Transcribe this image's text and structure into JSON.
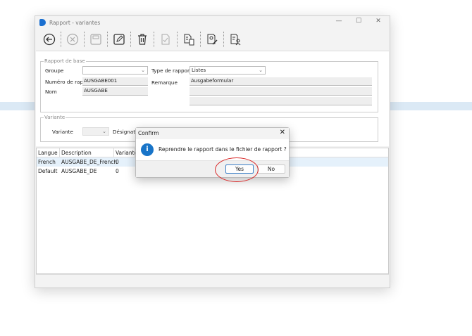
{
  "window": {
    "title": "Rapport - variantes",
    "minimize": "—",
    "maximize": "☐",
    "close": "✕"
  },
  "toolbar": [
    "back-icon",
    "cancel-icon",
    "save-icon",
    "edit-icon",
    "delete-icon",
    "check-document-icon",
    "copy-document-icon",
    "edit-report-icon",
    "report-user-icon"
  ],
  "base": {
    "legend": "Rapport de base",
    "groupe_label": "Groupe",
    "groupe_value": "",
    "type_label": "Type de rapport",
    "type_value": "Listes",
    "numero_label": "Numéro de rappo",
    "numero_value": "AUSGABE001",
    "remarque_label": "Remarque",
    "remarque_value": "Ausgabeformular",
    "nom_label": "Nom",
    "nom_value": "AUSGABE"
  },
  "variante": {
    "legend": "Variante",
    "variante_label": "Variante",
    "variante_value": "",
    "designation_label": "Désignatio"
  },
  "grid": {
    "headers": [
      "Langue",
      "Description",
      "Variante"
    ],
    "rows": [
      [
        "French",
        "AUSGABE_DE_French",
        "0"
      ],
      [
        "Default",
        "AUSGABE_DE",
        "0"
      ]
    ]
  },
  "dialog": {
    "title": "Confirm",
    "message": "Reprendre le rapport dans le fichier de rapport ?",
    "yes": "Yes",
    "no": "No",
    "close": "✕",
    "icon": "i"
  },
  "colors": {
    "accent": "#1874c8",
    "highlight": "#d92a2a"
  }
}
